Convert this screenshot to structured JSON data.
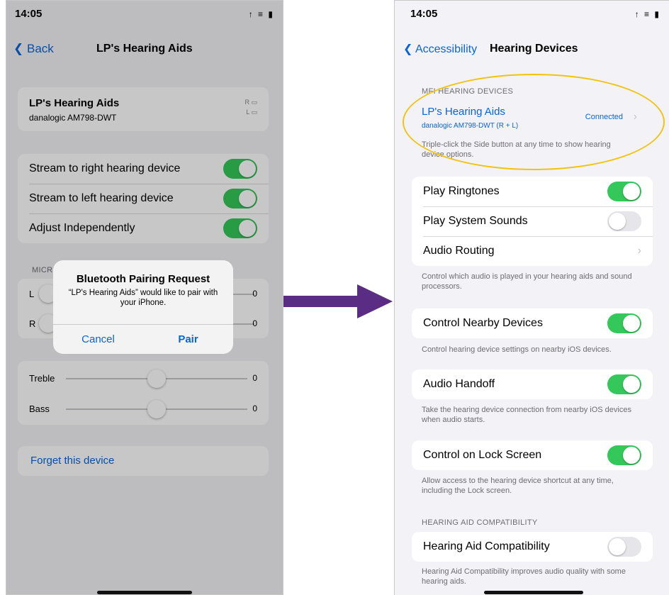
{
  "left": {
    "status": {
      "time": "14:05",
      "icons": "↑ ≡ ▮"
    },
    "nav": {
      "back_label": "Back",
      "title": "LP's Hearing Aids"
    },
    "device": {
      "name": "LP's Hearing Aids",
      "model": "danalogic AM798-DWT",
      "battery_r": "R",
      "battery_l": "L"
    },
    "toggles": [
      {
        "label": "Stream to right hearing device",
        "on": true
      },
      {
        "label": "Stream to left hearing device",
        "on": true
      },
      {
        "label": "Adjust Independently",
        "on": true
      }
    ],
    "mic_header": "MICR",
    "mic_rows": [
      {
        "label": "L",
        "value": "0"
      },
      {
        "label": "R",
        "value": "0"
      }
    ],
    "tone_rows": [
      {
        "label": "Treble",
        "value": "0",
        "level": 0.5
      },
      {
        "label": "Bass",
        "value": "0",
        "level": 0.5
      }
    ],
    "forget_label": "Forget this device",
    "alert": {
      "title": "Bluetooth Pairing Request",
      "message": "“LP's Hearing Aids” would like to pair with your iPhone.",
      "cancel": "Cancel",
      "pair": "Pair"
    }
  },
  "right": {
    "status": {
      "time": "14:05",
      "icons": "↑ ≡ ▮"
    },
    "nav": {
      "back_label": "Accessibility",
      "title": "Hearing Devices"
    },
    "mfi_header": "MFI HEARING DEVICES",
    "device": {
      "name": "LP's Hearing Aids",
      "model": "danalogic AM798-DWT (R + L)",
      "status": "Connected"
    },
    "mfi_footnote": "Triple-click the Side button at any time to show hearing device options.",
    "group1": [
      {
        "label": "Play Ringtones",
        "on": true
      },
      {
        "label": "Play System Sounds",
        "on": false
      },
      {
        "label": "Audio Routing"
      }
    ],
    "group1_footnote": "Control which audio is played in your hearing aids and sound processors.",
    "nearby": {
      "label": "Control Nearby Devices",
      "on": true,
      "footnote": "Control hearing device settings on nearby iOS devices."
    },
    "handoff": {
      "label": "Audio Handoff",
      "on": true,
      "footnote": "Take the hearing device connection from nearby iOS devices when audio starts."
    },
    "lock": {
      "label": "Control on Lock Screen",
      "on": true,
      "footnote": "Allow access to the hearing device shortcut at any time, including the Lock screen."
    },
    "hac_header": "HEARING AID COMPATIBILITY",
    "hac": {
      "label": "Hearing Aid Compatibility",
      "on": false,
      "footnote": "Hearing Aid Compatibility improves audio quality with some hearing aids."
    }
  },
  "colors": {
    "accent": "#0a64d8",
    "toggle_on": "#34c759",
    "arrow": "#5b2c83",
    "highlight": "#f1c40f"
  }
}
